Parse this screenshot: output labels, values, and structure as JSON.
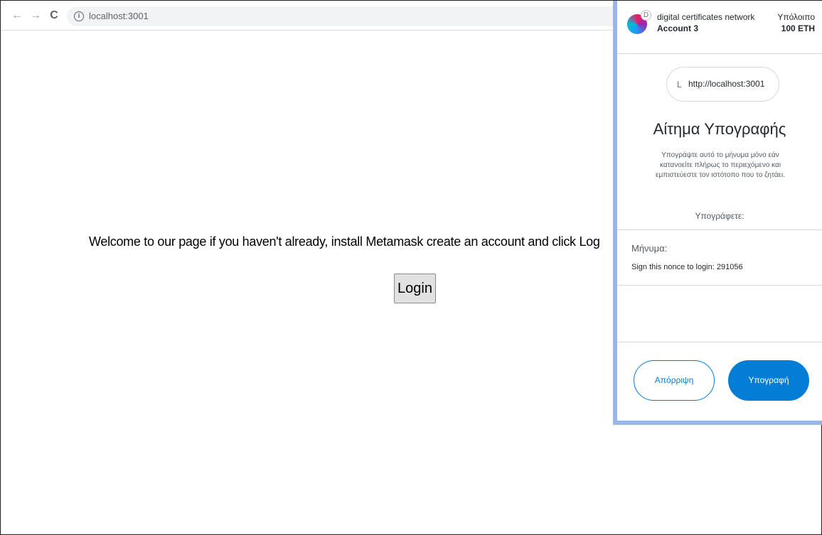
{
  "browser": {
    "back_icon": "←",
    "forward_icon": "→",
    "reload_icon": "C",
    "info_icon": "i",
    "url": "localhost:3001"
  },
  "page": {
    "welcome_text": "Welcome to our page if you haven't already, install Metamask create an account and click Log",
    "login_label": "Login"
  },
  "metamask": {
    "header": {
      "site_initial": "D",
      "network": "digital certificates network",
      "account": "Account 3",
      "balance_label": "Υπόλοιπο",
      "balance_value": "100 ETH"
    },
    "origin": {
      "initial": "L",
      "url": "http://localhost:3001"
    },
    "title": "Αίτημα Υπογραφής",
    "description": "Υπογράψτε αυτό το μήνυμα μόνο εάν κατανοείτε πλήρως το περιεχόμενο και εμπιστεύεστε τον ιστότοπο που το ζητάει.",
    "signing_label": "Υπογράφετε:",
    "message_label": "Μήνυμα:",
    "message_value": "Sign this nonce to login: 291056",
    "reject_label": "Απόρριψη",
    "sign_label": "Υπογραφή",
    "accent_color": "#037dd6"
  }
}
